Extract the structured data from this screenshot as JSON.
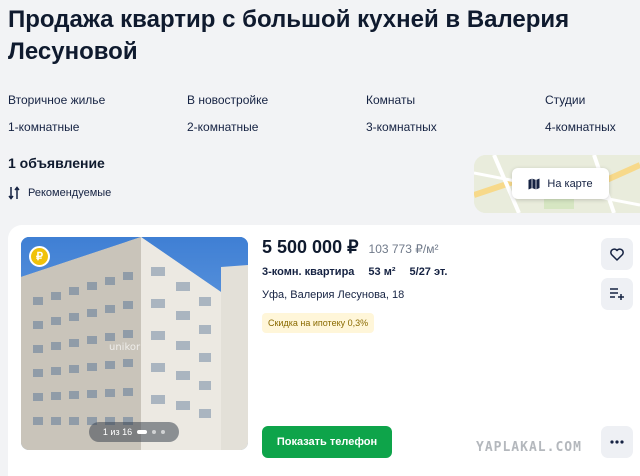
{
  "page_title": "Продажа квартир с большой кухней в Валерия Лесуновой",
  "filters": [
    "Вторичное жилье",
    "В новостройке",
    "Комнаты",
    "Студии",
    "1-комнатные",
    "2-комнатные",
    "3-комнатных",
    "4-комнатных"
  ],
  "results_count": "1 объявление",
  "sort_label": "Рекомендуемые",
  "map_button_label": "На карте",
  "listing": {
    "price": "5 500 000 ₽",
    "price_per_m2": "103 773 ₽/м²",
    "room_type": "3-комн. квартира",
    "area": "53 м²",
    "floor": "5/27 эт.",
    "address": "Уфа, Валерия Лесунова, 18",
    "mortgage_badge": "Скидка на ипотеку 0,3%",
    "photo_counter": "1 из 16",
    "photo_watermark": "unikor",
    "ruble_badge": "₽",
    "show_phone_label": "Показать телефон"
  },
  "watermark": "YAPLAKAL.COM",
  "colors": {
    "primary_green": "#0ea44a",
    "text": "#152242",
    "badge_yellow_bg": "#fff6d9",
    "ruble_badge": "#f0c20a"
  }
}
